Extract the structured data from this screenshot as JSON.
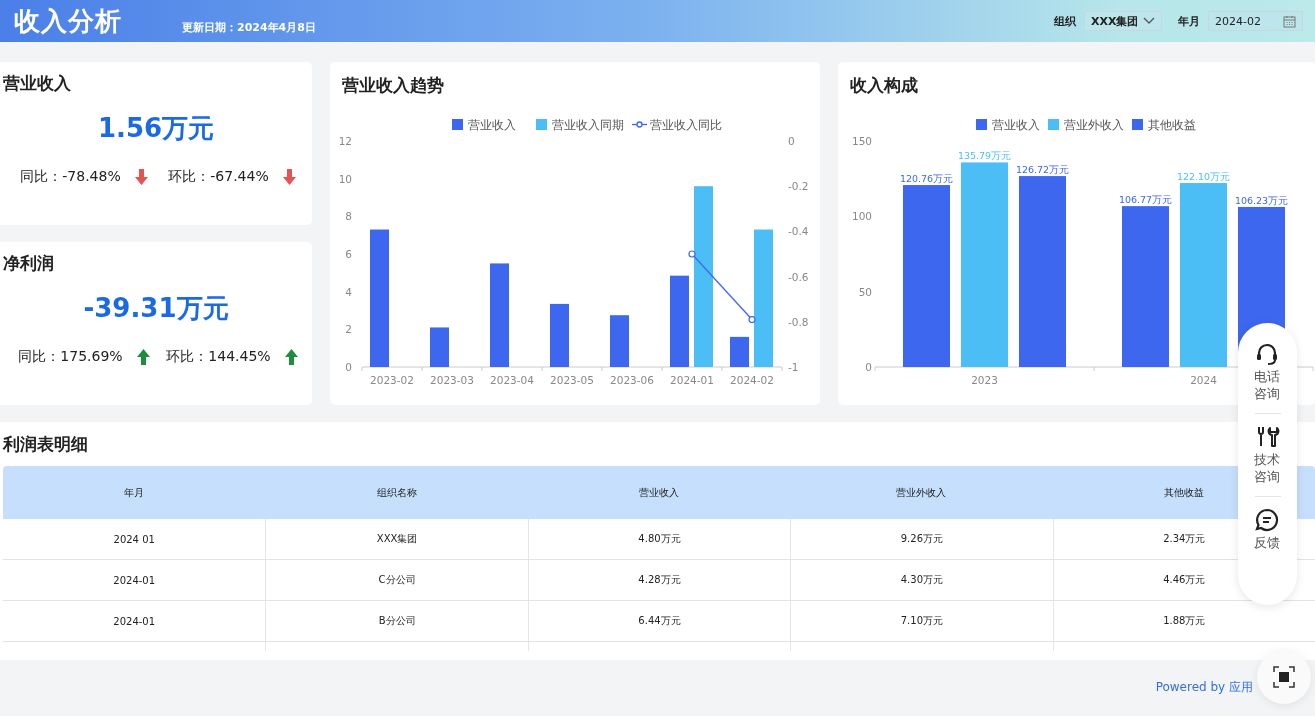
{
  "header": {
    "title": "收入分析",
    "update_date": "更新日期：2024年4月8日",
    "org_label": "组织",
    "org_value": "XXX集团",
    "month_label": "年月",
    "month_value": "2024-02"
  },
  "kpis": [
    {
      "title": "营业收入",
      "value": "1.56万元",
      "metrics": [
        {
          "label": "同比：-78.48%",
          "rising": false
        },
        {
          "label": "环比：-67.44%",
          "rising": false
        }
      ]
    },
    {
      "title": "净利润",
      "value": "-39.31万元",
      "metrics": [
        {
          "label": "同比：175.69%",
          "rising": true
        },
        {
          "label": "环比：144.45%",
          "rising": true
        }
      ]
    }
  ],
  "trend_chart": {
    "title": "营业收入趋势",
    "chart_data": {
      "type": "bar",
      "categories": [
        "2023-02",
        "2023-03",
        "2023-04",
        "2023-05",
        "2023-06",
        "2024-01",
        "2024-02"
      ],
      "ylim": [
        0,
        12
      ],
      "yticks": [
        0,
        2,
        4,
        6,
        8,
        10,
        12
      ],
      "y2lim": [
        -1,
        0
      ],
      "y2ticks": [
        0,
        -0.2,
        -0.4,
        -0.6,
        -0.8,
        -1
      ],
      "legend": "top",
      "series": [
        {
          "name": "营业收入",
          "color": "#3d67ee",
          "type": "bar",
          "values": [
            7.3,
            2.1,
            5.5,
            3.35,
            2.75,
            4.85,
            1.6
          ]
        },
        {
          "name": "营业收入同期",
          "color": "#4bbff5",
          "type": "bar",
          "values": [
            null,
            null,
            null,
            null,
            null,
            9.6,
            7.3
          ]
        },
        {
          "name": "营业收入同比",
          "color": "#3d67ee",
          "type": "line",
          "axis": "y2",
          "marker": "circle",
          "values": [
            null,
            null,
            null,
            null,
            null,
            -0.5,
            -0.79
          ]
        }
      ]
    }
  },
  "composition_chart": {
    "title": "收入构成",
    "chart_data": {
      "type": "bar",
      "categories": [
        "2023",
        "2024"
      ],
      "ylim": [
        0,
        150
      ],
      "yticks": [
        0,
        50,
        100,
        150
      ],
      "legend": "top",
      "series": [
        {
          "name": "营业收入",
          "color": "#3d67ee",
          "values": [
            120.76,
            106.77
          ],
          "value_labels": [
            "120.76万元",
            "106.77万元"
          ]
        },
        {
          "name": "营业外收入",
          "color": "#4bbff5",
          "values": [
            135.79,
            122.1
          ],
          "value_labels": [
            "135.79万元",
            "122.10万元"
          ]
        },
        {
          "name": "其他收益",
          "color": "#3d67ee",
          "values": [
            126.72,
            106.23
          ],
          "value_labels": [
            "126.72万元",
            "106.23万元"
          ]
        }
      ]
    }
  },
  "detail_table": {
    "title": "利润表明细",
    "columns": [
      "年月",
      "组织名称",
      "营业收入",
      "营业外收入",
      "其他收益"
    ],
    "rows": [
      [
        "2024 01",
        "XXX集团",
        "4.80万元",
        "9.26万元",
        "2.34万元"
      ],
      [
        "2024-01",
        "C分公司",
        "4.28万元",
        "4.30万元",
        "4.46万元"
      ],
      [
        "2024-01",
        "B分公司",
        "6.44万元",
        "7.10万元",
        "1.88万元"
      ]
    ]
  },
  "float_menu": [
    {
      "label": "电话咨询",
      "kind": "phone"
    },
    {
      "label": "技术咨询",
      "kind": "tools"
    },
    {
      "label": "反馈",
      "kind": "feedback"
    }
  ],
  "footer": {
    "powered_by": "Powered by 应用"
  }
}
